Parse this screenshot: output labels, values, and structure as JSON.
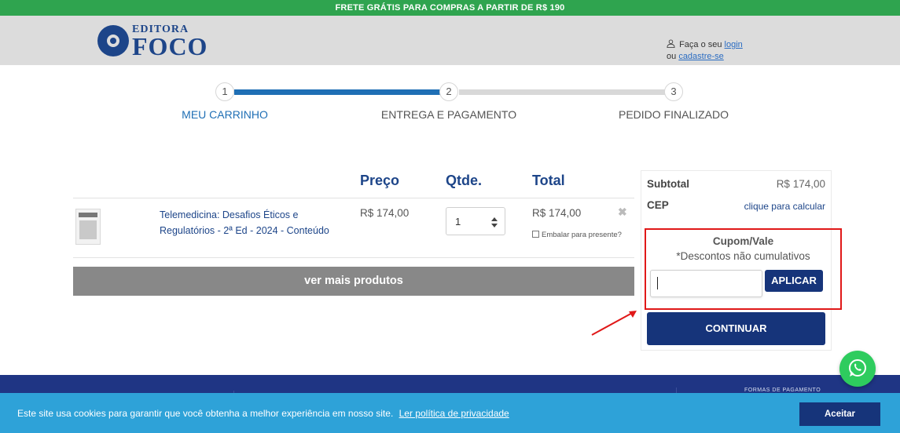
{
  "topbar": {
    "text": "FRETE GRÁTIS PARA COMPRAS A PARTIR DE R$ 190"
  },
  "header": {
    "logo_top": "EDITORA",
    "logo_main": "FOCO",
    "login_prefix": "Faça o seu",
    "login_link": "login",
    "register_prefix": "ou",
    "register_link": "cadastre-se"
  },
  "steps": [
    {
      "number": "1",
      "label": "MEU CARRINHO",
      "active": true
    },
    {
      "number": "2",
      "label": "ENTREGA E PAGAMENTO",
      "active": false
    },
    {
      "number": "3",
      "label": "PEDIDO FINALIZADO",
      "active": false
    }
  ],
  "cart": {
    "columns": {
      "price": "Preço",
      "qty": "Qtde.",
      "total": "Total"
    },
    "items": [
      {
        "name": "Telemedicina: Desafios Éticos e Regulatórios - 2ª Ed - 2024 - Conteúdo",
        "price": "R$ 174,00",
        "qty": "1",
        "total": "R$ 174,00",
        "gift_label": "Embalar para presente?"
      }
    ],
    "more_button": "ver mais produtos"
  },
  "summary": {
    "subtotal_label": "Subtotal",
    "subtotal_value": "R$ 174,00",
    "cep_label": "CEP",
    "cep_link": "clique para calcular",
    "coupon_title": "Cupom/Vale",
    "coupon_note": "*Descontos não cumulativos",
    "coupon_value": "",
    "apply_button": "APLICAR",
    "continue_button": "CONTINUAR"
  },
  "footer": {
    "payment_title": "FORMAS DE PAGAMENTO"
  },
  "cookie": {
    "text": "Este site usa cookies para garantir que você obtenha a melhor experiência em nosso site.",
    "link": "Ler política de privacidade",
    "accept": "Aceitar"
  },
  "colors": {
    "topbar": "#2fa44f",
    "brand_blue": "#16347a",
    "progress_blue": "#1f6fb5",
    "highlight_red": "#e01818",
    "cookie_bg": "#2ea2d8",
    "whatsapp": "#2ecc5e"
  },
  "icons": [
    "user-icon",
    "remove-icon",
    "whatsapp-icon",
    "arrow-annotation-icon",
    "quantity-stepper-icon"
  ]
}
